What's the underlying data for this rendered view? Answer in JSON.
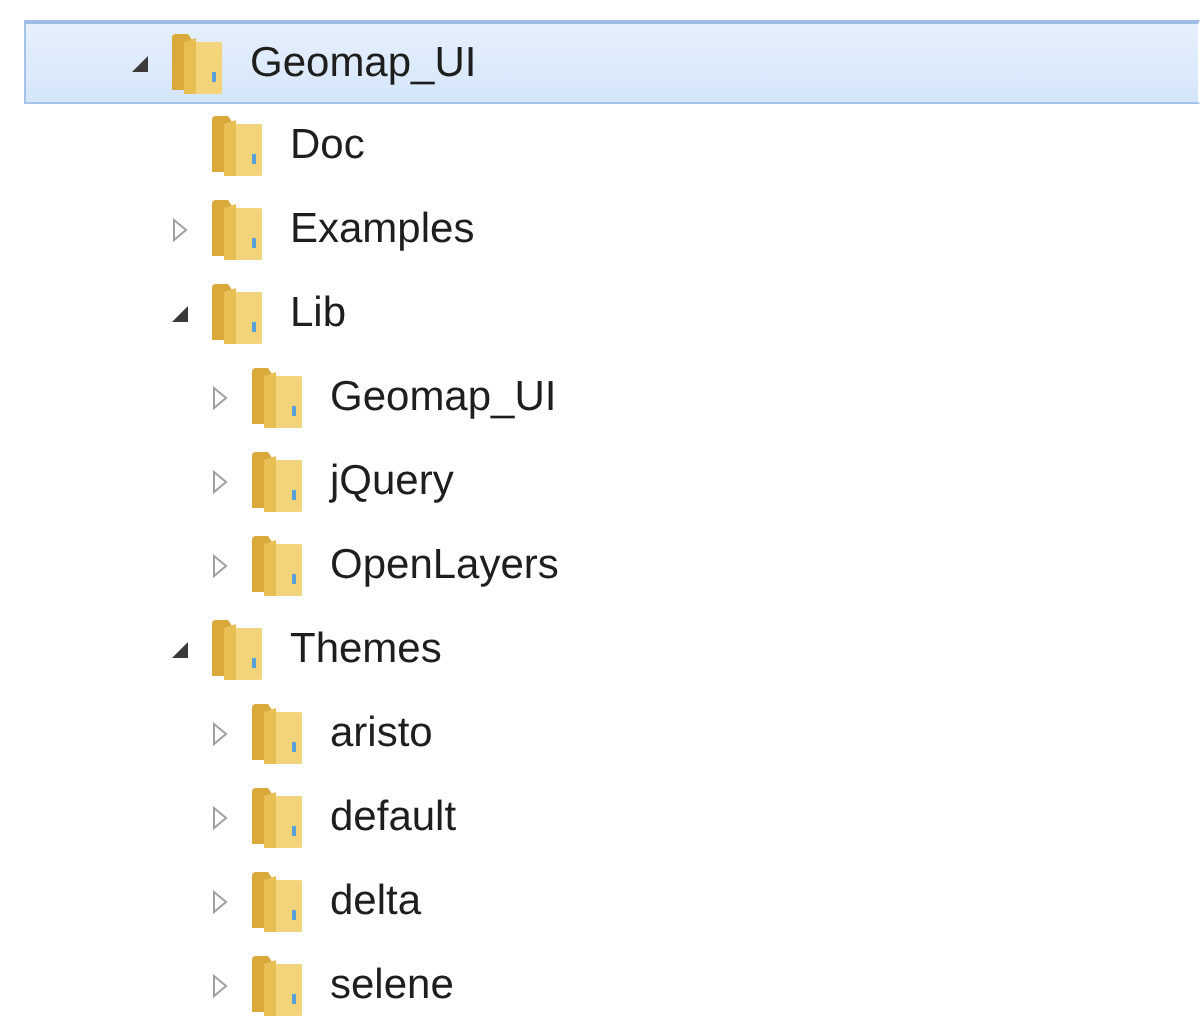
{
  "tree": [
    {
      "label": "Geomap_UI",
      "selected": true,
      "expanded": true,
      "children": [
        {
          "label": "Doc",
          "selected": false
        },
        {
          "label": "Examples",
          "selected": false,
          "expanded": false
        },
        {
          "label": "Lib",
          "selected": false,
          "expanded": true,
          "children": [
            {
              "label": "Geomap_UI",
              "selected": false,
              "expanded": false
            },
            {
              "label": "jQuery",
              "selected": false,
              "expanded": false
            },
            {
              "label": "OpenLayers",
              "selected": false,
              "expanded": false
            }
          ]
        },
        {
          "label": "Themes",
          "selected": false,
          "expanded": true,
          "children": [
            {
              "label": "aristo",
              "selected": false,
              "expanded": false
            },
            {
              "label": "default",
              "selected": false,
              "expanded": false
            },
            {
              "label": "delta",
              "selected": false,
              "expanded": false
            },
            {
              "label": "selene",
              "selected": false,
              "expanded": false
            }
          ]
        }
      ]
    }
  ]
}
